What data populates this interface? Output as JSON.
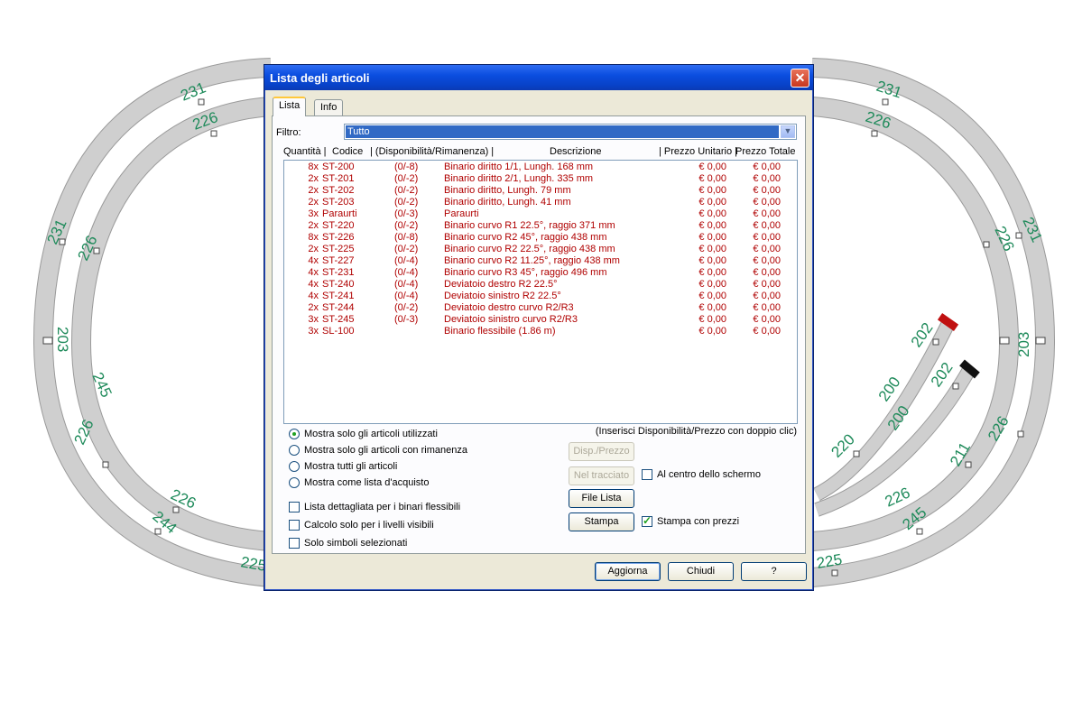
{
  "track_labels": [
    "231",
    "226",
    "231",
    "226",
    "231",
    "226",
    "231",
    "226",
    "203",
    "203",
    "245",
    "226",
    "202",
    "202",
    "200",
    "200",
    "220",
    "244",
    "226",
    "226",
    "226",
    "245",
    "225",
    "225",
    "211",
    "226",
    "244"
  ],
  "dialog": {
    "title": "Lista degli articoli",
    "close_symbol": "✕",
    "tabs": [
      "Lista",
      "Info"
    ],
    "filter": {
      "label": "Filtro:",
      "value": "Tutto"
    },
    "columns": [
      "Quantità |",
      "Codice",
      "| (Disponibilità/Rimanenza) |",
      "Descrizione",
      "| Prezzo Unitario |",
      "Prezzo Totale"
    ],
    "rows": [
      [
        "8x",
        "ST-200",
        "(0/-8)",
        "Binario diritto 1/1, Lungh. 168 mm",
        "€ 0,00",
        "€ 0,00"
      ],
      [
        "2x",
        "ST-201",
        "(0/-2)",
        "Binario diritto 2/1, Lungh. 335 mm",
        "€ 0,00",
        "€ 0,00"
      ],
      [
        "2x",
        "ST-202",
        "(0/-2)",
        "Binario diritto, Lungh. 79 mm",
        "€ 0,00",
        "€ 0,00"
      ],
      [
        "2x",
        "ST-203",
        "(0/-2)",
        "Binario diritto, Lungh. 41 mm",
        "€ 0,00",
        "€ 0,00"
      ],
      [
        "3x",
        "Paraurti",
        "(0/-3)",
        "Paraurti",
        "€ 0,00",
        "€ 0,00"
      ],
      [
        "2x",
        "ST-220",
        "(0/-2)",
        "Binario curvo R1 22.5°, raggio 371 mm",
        "€ 0,00",
        "€ 0,00"
      ],
      [
        "8x",
        "ST-226",
        "(0/-8)",
        "Binario curvo R2 45°, raggio 438 mm",
        "€ 0,00",
        "€ 0,00"
      ],
      [
        "2x",
        "ST-225",
        "(0/-2)",
        "Binario curvo R2 22.5°, raggio 438 mm",
        "€ 0,00",
        "€ 0,00"
      ],
      [
        "4x",
        "ST-227",
        "(0/-4)",
        "Binario curvo R2 11.25°, raggio 438 mm",
        "€ 0,00",
        "€ 0,00"
      ],
      [
        "4x",
        "ST-231",
        "(0/-4)",
        "Binario curvo R3 45°, raggio 496 mm",
        "€ 0,00",
        "€ 0,00"
      ],
      [
        "4x",
        "ST-240",
        "(0/-4)",
        "Deviatoio destro R2 22.5°",
        "€ 0,00",
        "€ 0,00"
      ],
      [
        "4x",
        "ST-241",
        "(0/-4)",
        "Deviatoio sinistro R2 22.5°",
        "€ 0,00",
        "€ 0,00"
      ],
      [
        "2x",
        "ST-244",
        "(0/-2)",
        "Deviatoio destro curvo R2/R3",
        "€ 0,00",
        "€ 0,00"
      ],
      [
        "3x",
        "ST-245",
        "(0/-3)",
        "Deviatoio sinistro curvo R2/R3",
        "€ 0,00",
        "€ 0,00"
      ],
      [
        "3x",
        "SL-100",
        "",
        "Binario flessibile (1.86 m)",
        "€ 0,00",
        "€ 0,00"
      ]
    ],
    "hint": "(Inserisci Disponibilità/Prezzo con doppio clic)",
    "radio_options": [
      {
        "label": "Mostra solo gli articoli utilizzati",
        "selected": true
      },
      {
        "label": "Mostra solo gli articoli con rimanenza",
        "selected": false
      },
      {
        "label": "Mostra tutti gli articoli",
        "selected": false
      },
      {
        "label": "Mostra come lista d'acquisto",
        "selected": false
      }
    ],
    "checkboxes": [
      {
        "label": "Lista dettagliata per i binari flessibili",
        "checked": false
      },
      {
        "label": "Calcolo solo per i livelli visibili",
        "checked": false
      },
      {
        "label": "Solo simboli selezionati",
        "checked": false
      }
    ],
    "buttons": {
      "disp_prezzo": "Disp./Prezzo",
      "nel_tracciato": "Nel tracciato",
      "file_lista": "File Lista",
      "stampa": "Stampa",
      "aggiorna": "Aggiorna",
      "chiudi": "Chiudi",
      "help": "?"
    },
    "al_centro": {
      "label": "Al centro dello schermo",
      "checked": false
    },
    "stampa_prezzi": {
      "label": "Stampa con prezzi",
      "checked": true
    }
  }
}
